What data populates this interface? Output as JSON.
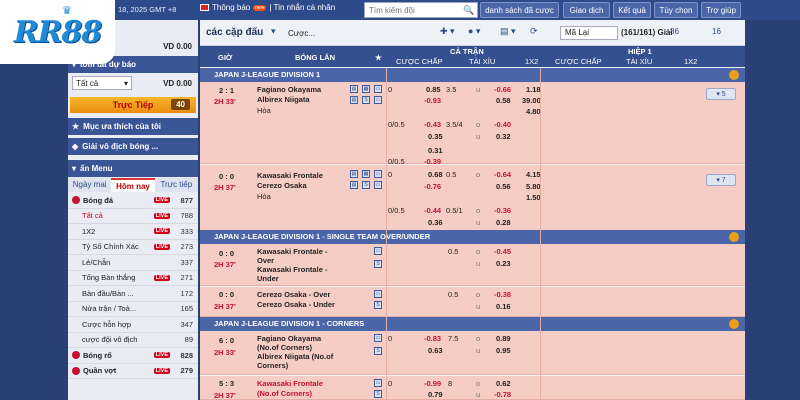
{
  "top": {
    "date": "18, 2025 GMT +8",
    "notice": "Thông báo",
    "notice_badge": "new",
    "messages": "| Tin nhắn cá nhân",
    "search_placeholder": "Tìm kiếm đội",
    "nav": [
      "danh sách đã cược",
      "Giao dịch",
      "Kết quả",
      "Tùy chọn",
      "Trợ giúp"
    ]
  },
  "logo": {
    "text": "RR88"
  },
  "sidebar": {
    "vnd_top": "VD 0.00",
    "summary_title": "tóm tắt dự báo",
    "select_value": "Tất cả",
    "vnd": "VD 0.00",
    "live_label": "Trực Tiếp",
    "live_count": "40",
    "favorites": "Mục ưa thích của tôi",
    "champion": "Giải vô địch bóng ...",
    "hide_menu": "ẩn Menu",
    "tabs": [
      "Ngày mai",
      "Hôm nay",
      "Trực tiếp"
    ],
    "sports": [
      {
        "name": "Bóng đá",
        "count": "877",
        "live": "LIVE",
        "head": true
      },
      {
        "name": "Tất cả",
        "count": "788",
        "live": "LIVE",
        "sub": true,
        "sel": true
      },
      {
        "name": "1X2",
        "count": "333",
        "live": "LIVE",
        "sub": true
      },
      {
        "name": "Tỷ Số Chính Xác",
        "count": "273",
        "live": "LIVE",
        "sub": true
      },
      {
        "name": "Lẻ/Chẵn",
        "count": "337",
        "live": "",
        "sub": true
      },
      {
        "name": "Tổng Bàn thắng",
        "count": "271",
        "live": "LIVE",
        "sub": true
      },
      {
        "name": "Bàn đầu/Bàn ...",
        "count": "172",
        "live": "",
        "sub": true
      },
      {
        "name": "Nửa trận / Toà...",
        "count": "165",
        "live": "",
        "sub": true
      },
      {
        "name": "Cược hỗn hợp",
        "count": "347",
        "live": "",
        "sub": true
      },
      {
        "name": "cược đội vô địch",
        "count": "89",
        "live": "",
        "sub": true
      },
      {
        "name": "Bóng rổ",
        "count": "828",
        "live": "LIVE",
        "head": true
      },
      {
        "name": "Quần vợt",
        "count": "279",
        "live": "LIVE",
        "head": true
      }
    ]
  },
  "main": {
    "title": "các cặp đấu",
    "bet_label": "Cược...",
    "sort": "Mã Lại",
    "giai": "(161/161) Giải",
    "count_a": "86",
    "count_b": "16",
    "headers": {
      "time": "GIỜ",
      "teams": "BÓNG LĂN",
      "full": "CẢ TRẬN",
      "half": "HIỆP 1",
      "handicap": "CƯỢC CHẤP",
      "ou": "TÀI XỈU",
      "x12": "1X2",
      "handicap2": "CƯỢC CHẤP",
      "ou2": "TÀI XỈU",
      "x12_2": "1X2"
    },
    "leagues": [
      "JAPAN J-LEAGUE DIVISION 1",
      "JAPAN J-LEAGUE DIVISION 1 - SINGLE TEAM OVER/UNDER",
      "JAPAN J-LEAGUE DIVISION 1 - CORNERS"
    ],
    "m1": {
      "score": "2 : 1",
      "time": "2H 33'",
      "home": "Fagiano Okayama",
      "away": "Albirex Niigata",
      "draw": "Hòa",
      "r1": [
        "0",
        "0.85",
        "3.5",
        "u",
        "-0.66",
        "1.18"
      ],
      "r1b": [
        "-0.93",
        "0.58",
        "39.00"
      ],
      "r1c": "4.80",
      "r2": [
        "0/0.5",
        "-0.43",
        "3.5/4",
        "o",
        "-0.40"
      ],
      "r2b": [
        "0.35",
        "u",
        "0.32"
      ],
      "r3": "0.31",
      "r4": [
        "0/0.5",
        "-0.39"
      ],
      "more": "5"
    },
    "m2": {
      "score": "0 : 0",
      "time": "2H 37'",
      "home": "Kawasaki Frontale",
      "away": "Cerezo Osaka",
      "draw": "Hòa",
      "r1": [
        "0",
        "0.68",
        "0.5",
        "o",
        "-0.64",
        "4.15"
      ],
      "r1b": [
        "-0.76",
        "0.56",
        "5.80"
      ],
      "r1c": "1.50",
      "r2": [
        "0/0.5",
        "-0.44",
        "0.5/1",
        "o",
        "-0.36"
      ],
      "r2b": [
        "0.36",
        "u",
        "0.28"
      ],
      "more": "7"
    },
    "m3": {
      "score": "0 : 0",
      "time": "2H 37'",
      "home": "Kawasaki Frontale - Over",
      "away": "Kawasaki Frontale - Under",
      "r1": [
        "0.5",
        "o",
        "-0.45"
      ],
      "r1b": [
        "u",
        "0.23"
      ]
    },
    "m4": {
      "score": "0 : 0",
      "time": "2H 37'",
      "home": "Cerezo Osaka - Over",
      "away": "Cerezo Osaka - Under",
      "r1": [
        "0.5",
        "o",
        "-0.38"
      ],
      "r1b": [
        "u",
        "0.16"
      ]
    },
    "m5": {
      "score": "6 : 0",
      "time": "2H 33'",
      "home": "Fagiano Okayama (No.of Corners)",
      "away": "Albirex Niigata (No.of Corners)",
      "r1": [
        "0",
        "-0.83",
        "7.5",
        "o",
        "0.89"
      ],
      "r1b": [
        "0.63",
        "u",
        "0.95"
      ]
    },
    "m6": {
      "score": "5 : 3",
      "time": "2H 37'",
      "home": "Kawasaki Frontale",
      "away": "(No.of Corners)",
      "r1": [
        "0",
        "-0.99",
        "8",
        "o",
        "0.62"
      ],
      "r1b": [
        "0.79",
        "u",
        "-0.78"
      ]
    }
  }
}
